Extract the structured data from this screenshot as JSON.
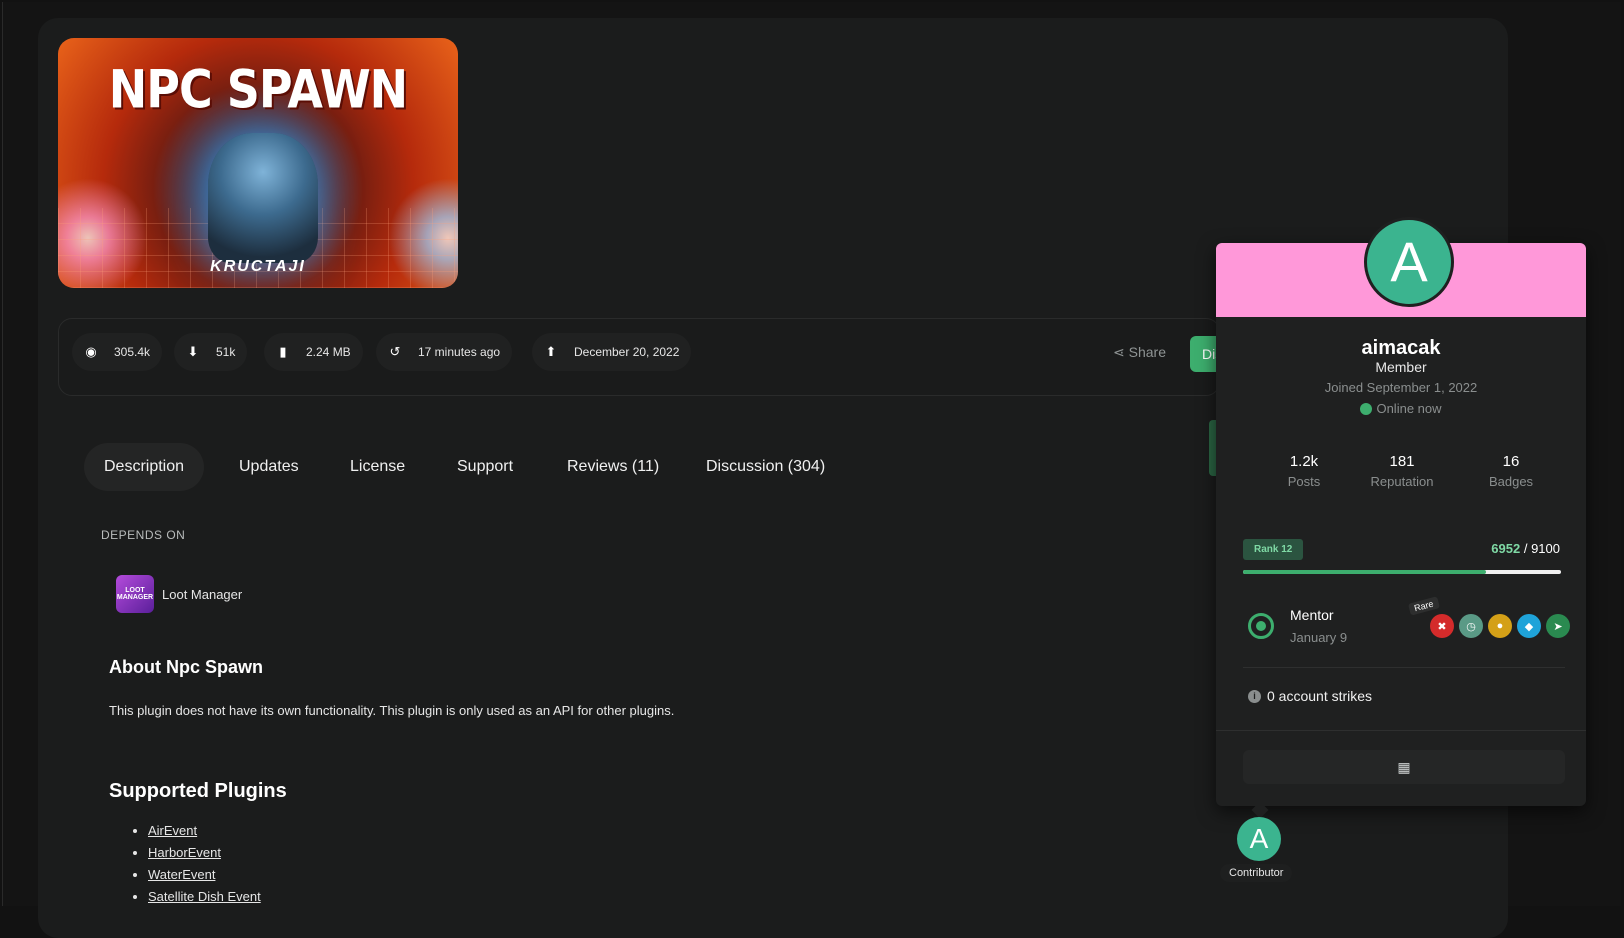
{
  "banner": {
    "title": "NPC SPAWN",
    "subtitle": "KRUCTAJI"
  },
  "stats": [
    {
      "icon": "eye-icon",
      "value": "305.4k"
    },
    {
      "icon": "download-icon",
      "value": "51k"
    },
    {
      "icon": "file-icon",
      "value": "2.24 MB"
    },
    {
      "icon": "history-icon",
      "value": "17 minutes ago"
    },
    {
      "icon": "upload-icon",
      "value": "December 20, 2022"
    }
  ],
  "actions": {
    "share": "Share",
    "download_label": "Dis"
  },
  "tabs": [
    "Description",
    "Updates",
    "License",
    "Support",
    "Reviews (11)",
    "Discussion (304)"
  ],
  "depends": {
    "heading": "DEPENDS ON",
    "item": "Loot Manager",
    "thumb_text": "LOOT MANAGER"
  },
  "about": {
    "heading": "About Npc Spawn",
    "text": "This plugin does not have its own functionality. This plugin is only used as an API for other plugins."
  },
  "supported": {
    "heading": "Supported Plugins",
    "items": [
      "AirEvent",
      "HarborEvent",
      "WaterEvent",
      "Satellite Dish Event"
    ]
  },
  "profile": {
    "avatar_letter": "A",
    "cover_color": "#ff98d9",
    "username": "aimacak",
    "role": "Member",
    "joined": "Joined September 1, 2022",
    "online": "Online now",
    "metrics": [
      {
        "value": "1.2k",
        "label": "Posts"
      },
      {
        "value": "181",
        "label": "Reputation"
      },
      {
        "value": "16",
        "label": "Badges"
      }
    ],
    "rank": "Rank 12",
    "xp_current": "6952",
    "xp_total": "/ 9100",
    "xp_progress": 0.764,
    "badge_title": "Mentor",
    "badge_date": "January 9",
    "rare_label": "Rare",
    "badges": [
      {
        "icon": "rare-red-badge-icon",
        "color": "#d42b2b"
      },
      {
        "icon": "clock-badge-icon",
        "color": "#5a9a86"
      },
      {
        "icon": "chat-badge-icon",
        "color": "#d4a017"
      },
      {
        "icon": "diamond-badge-icon",
        "color": "#1fa3d9"
      },
      {
        "icon": "send-badge-icon",
        "color": "#2a8a50"
      }
    ],
    "strikes": "0 account strikes"
  },
  "contributor": {
    "avatar_letter": "A",
    "label": "Contributor"
  }
}
